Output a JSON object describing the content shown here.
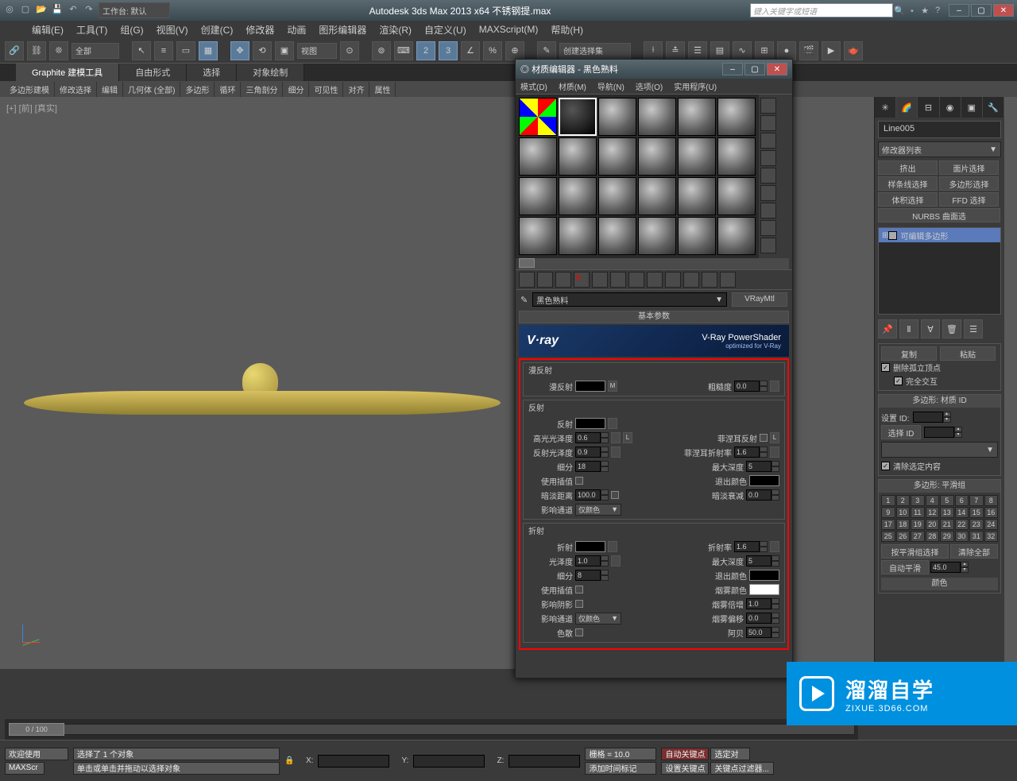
{
  "titlebar": {
    "workspace_label": "工作台: 默认",
    "title": "Autodesk 3ds Max  2013 x64    不锈钢提.max",
    "search_placeholder": "键入关键字或短语"
  },
  "menubar": [
    "编辑(E)",
    "工具(T)",
    "组(G)",
    "视图(V)",
    "创建(C)",
    "修改器",
    "动画",
    "图形编辑器",
    "渲染(R)",
    "自定义(U)",
    "MAXScript(M)",
    "帮助(H)"
  ],
  "toolbar": {
    "filter_all": "全部",
    "view_label": "视图",
    "selection_set": "创建选择集"
  },
  "ribbon": {
    "tabs": [
      "Graphite 建模工具",
      "自由形式",
      "选择",
      "对象绘制"
    ],
    "subtabs": [
      "多边形建模",
      "修改选择",
      "编辑",
      "几何体 (全部)",
      "多边形",
      "循环",
      "三角剖分",
      "细分",
      "可见性",
      "对齐",
      "属性"
    ]
  },
  "viewport": {
    "label": "[+] [前] [真实]"
  },
  "right_panel": {
    "object_name": "Line005",
    "modifier_list": "修改器列表",
    "buttons": [
      "挤出",
      "面片选择",
      "样条线选择",
      "多边形选择",
      "体积选择",
      "FFD 选择",
      "NURBS 曲面选",
      "",
      ""
    ],
    "stack_item": "可编辑多边形",
    "rollout_copy_paste": {
      "copy": "复制",
      "paste": "粘贴",
      "del_iso": "删除孤立顶点",
      "full_interact": "完全交互",
      "clear_sel": "清除选定内容"
    },
    "rollout_matid": {
      "title": "多边形: 材质 ID",
      "set_id": "设置 ID:",
      "sel_id": "选择 ID"
    },
    "rollout_smooth": {
      "title": "多边形: 平滑组",
      "grid": [
        "1",
        "2",
        "3",
        "4",
        "5",
        "6",
        "7",
        "8",
        "9",
        "10",
        "11",
        "12",
        "13",
        "14",
        "15",
        "16",
        "17",
        "18",
        "19",
        "20",
        "21",
        "22",
        "23",
        "24",
        "25",
        "26",
        "27",
        "28",
        "29",
        "30",
        "31",
        "32"
      ],
      "by_smooth": "按平滑组选择",
      "clear_all": "清除全部",
      "auto": "自动平滑",
      "auto_val": "45.0",
      "color": "颜色"
    }
  },
  "material_editor": {
    "title": "材质编辑器 - 黑色熟料",
    "menubar": [
      "模式(D)",
      "材质(M)",
      "导航(N)",
      "选项(O)",
      "实用程序(U)"
    ],
    "mat_name": "黑色熟料",
    "mat_type": "VRayMtl",
    "rollout_title": "基本参数",
    "vray_banner": {
      "logo": "V·ray",
      "line1": "V-Ray PowerShader",
      "line2": "optimized for V-Ray"
    },
    "params": {
      "diffuse": {
        "group": "漫反射",
        "label": "漫反射",
        "roughness": "粗糙度",
        "roughness_val": "0.0",
        "m": "M"
      },
      "reflect": {
        "group": "反射",
        "label": "反射",
        "hl_gloss": "高光光泽度",
        "hl_val": "0.6",
        "l": "L",
        "refl_gloss": "反射光泽度",
        "refl_val": "0.9",
        "fresnel": "菲涅耳反射",
        "fresnel_ior": "菲涅耳折射率",
        "fresnel_val": "1.6",
        "subdiv": "细分",
        "subdiv_val": "18",
        "max_depth": "最大深度",
        "max_depth_val": "5",
        "use_interp": "使用插值",
        "exit_color": "退出颜色",
        "dim_dist": "暗淡距离",
        "dim_dist_val": "100.0",
        "dim_fall": "暗淡衰减",
        "dim_fall_val": "0.0",
        "channel": "影响通道",
        "channel_val": "仅颜色"
      },
      "refract": {
        "group": "折射",
        "label": "折射",
        "ior": "折射率",
        "ior_val": "1.6",
        "gloss": "光泽度",
        "gloss_val": "1.0",
        "max_depth": "最大深度",
        "max_depth_val": "5",
        "subdiv": "细分",
        "subdiv_val": "8",
        "exit_color": "退出颜色",
        "use_interp": "使用插值",
        "fog_color": "烟雾颜色",
        "affect_shadow": "影响阴影",
        "fog_mult": "烟雾倍增",
        "fog_mult_val": "1.0",
        "channel": "影响通道",
        "channel_val": "仅颜色",
        "fog_bias": "烟雾偏移",
        "fog_bias_val": "0.0",
        "dispersion": "色散",
        "abbe": "阿贝",
        "abbe_val": "50.0"
      }
    }
  },
  "timeline": {
    "slider": "0 / 100"
  },
  "statusbar": {
    "welcome": "欢迎使用",
    "max_script": "MAXScr",
    "sel_info": "选择了 1 个对象",
    "hint": "单击或单击并拖动以选择对象",
    "x": "X:",
    "y": "Y:",
    "z": "Z:",
    "grid": "栅格 = 10.0",
    "add_time": "添加时间标记",
    "auto_key": "自动关键点",
    "sel_set": "选定对",
    "set_key": "设置关键点",
    "key_filter": "关键点过滤器..."
  },
  "watermark": {
    "cn": "溜溜自学",
    "en": "ZIXUE.3D66.COM"
  }
}
